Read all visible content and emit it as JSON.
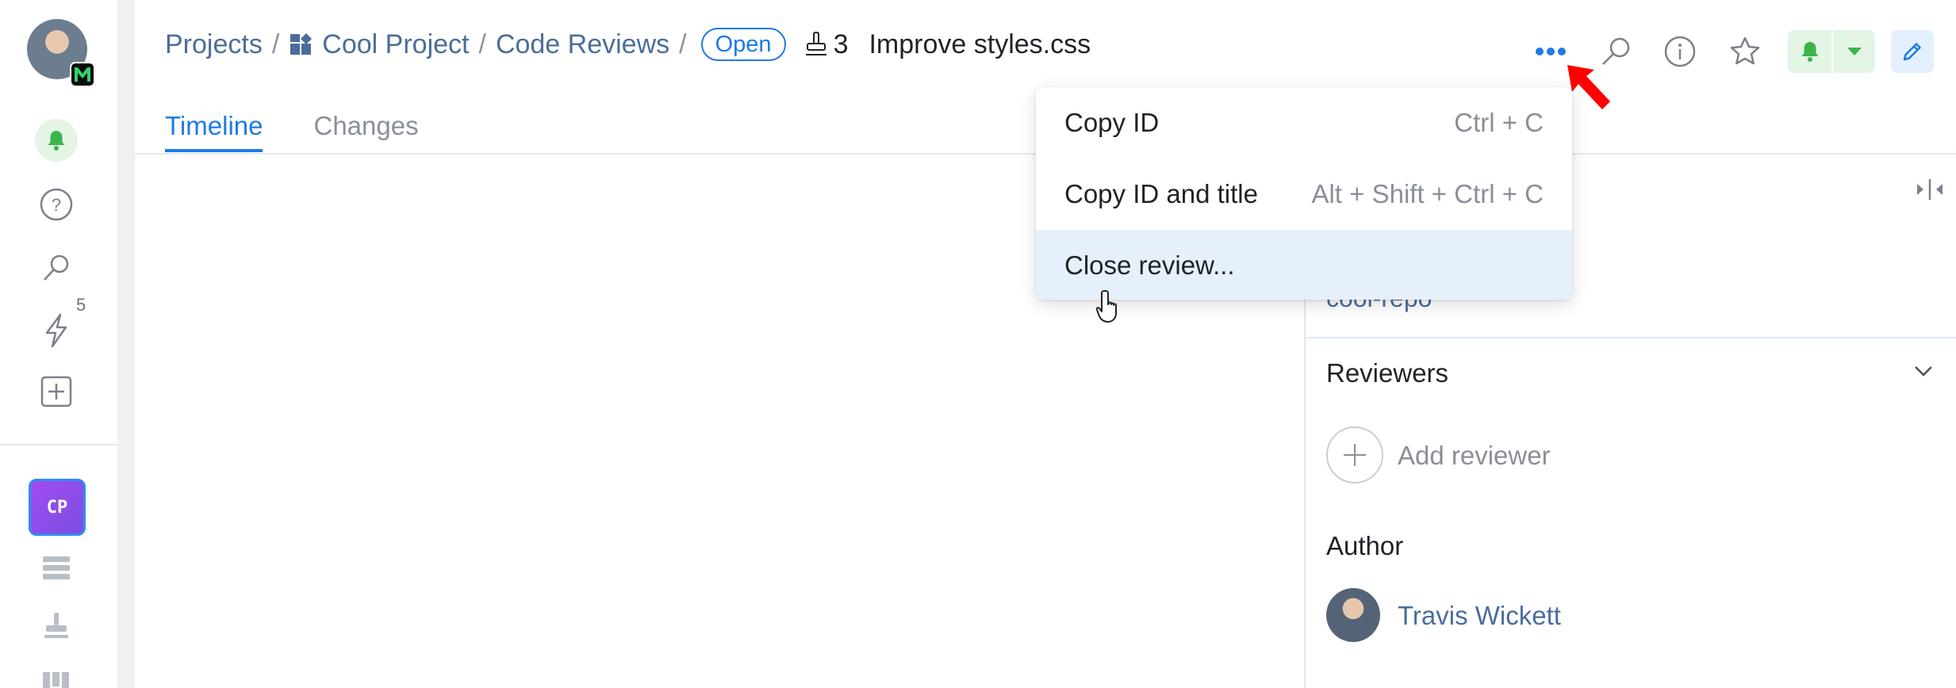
{
  "breadcrumb": {
    "projects": "Projects",
    "separator": "/",
    "project": "Cool Project",
    "section": "Code Reviews",
    "status": "Open",
    "review_number": "3",
    "review_title": "Improve styles.css"
  },
  "tabs": [
    {
      "label": "Timeline",
      "active": true
    },
    {
      "label": "Changes",
      "active": false
    }
  ],
  "rail": {
    "notifications_count": "5",
    "project_tile": "CP"
  },
  "menu": {
    "items": [
      {
        "label": "Copy ID",
        "shortcut": "Ctrl + C"
      },
      {
        "label": "Copy ID and title",
        "shortcut": "Alt + Shift + Ctrl + C"
      },
      {
        "label": "Close review...",
        "shortcut": "",
        "highlighted": true
      }
    ]
  },
  "panel": {
    "repo": "cool-repo",
    "reviewers_title": "Reviewers",
    "add_reviewer": "Add reviewer",
    "author_title": "Author",
    "author_name": "Travis Wickett"
  },
  "colors": {
    "accent": "#1e7ae6",
    "link": "#4b6d9b",
    "green": "#3cb44b",
    "annotation_arrow": "#ff0000",
    "menu_highlight": "#e6f0fb"
  }
}
